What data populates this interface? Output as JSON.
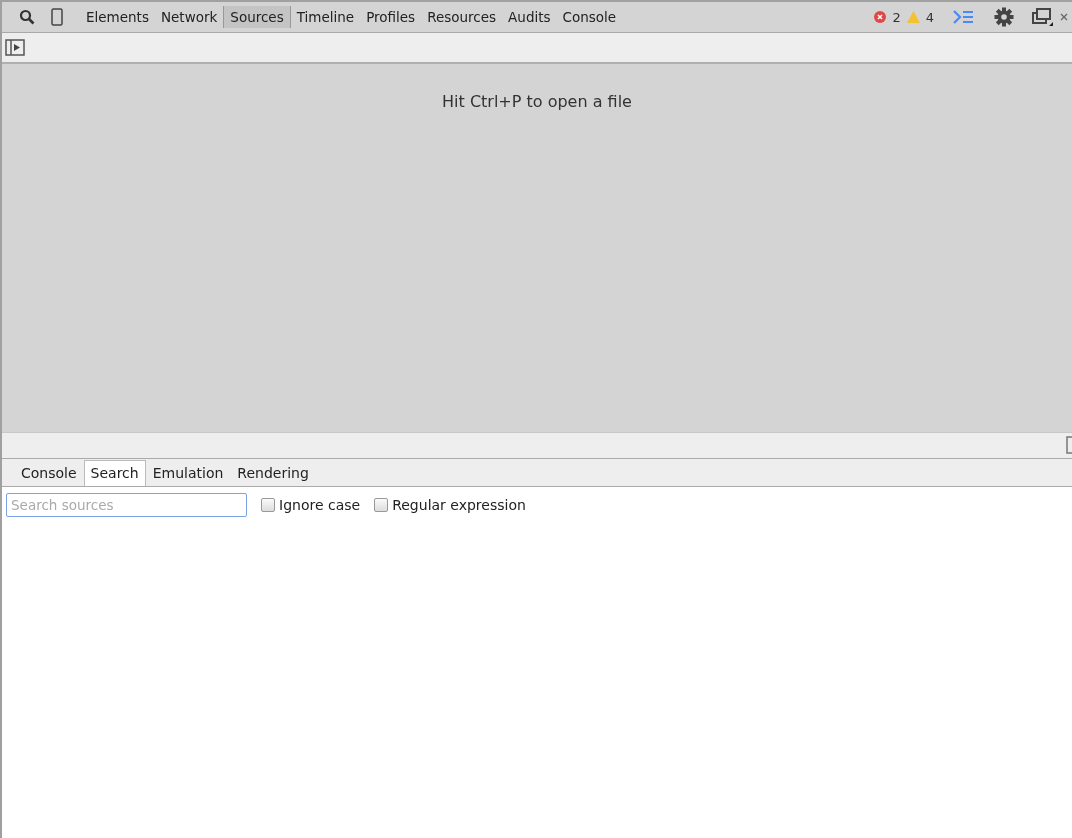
{
  "main_tabs": [
    {
      "label": "Elements",
      "selected": false
    },
    {
      "label": "Network",
      "selected": false
    },
    {
      "label": "Sources",
      "selected": true
    },
    {
      "label": "Timeline",
      "selected": false
    },
    {
      "label": "Profiles",
      "selected": false
    },
    {
      "label": "Resources",
      "selected": false
    },
    {
      "label": "Audits",
      "selected": false
    },
    {
      "label": "Console",
      "selected": false
    }
  ],
  "status": {
    "errors": "2",
    "warnings": "4"
  },
  "editor": {
    "hint": "Hit Ctrl+P to open a file"
  },
  "drawer_tabs": [
    {
      "label": "Console",
      "selected": false
    },
    {
      "label": "Search",
      "selected": true
    },
    {
      "label": "Emulation",
      "selected": false
    },
    {
      "label": "Rendering",
      "selected": false
    }
  ],
  "search": {
    "placeholder": "Search sources",
    "options": [
      {
        "label": "Ignore case",
        "checked": false
      },
      {
        "label": "Regular expression",
        "checked": false
      }
    ]
  }
}
